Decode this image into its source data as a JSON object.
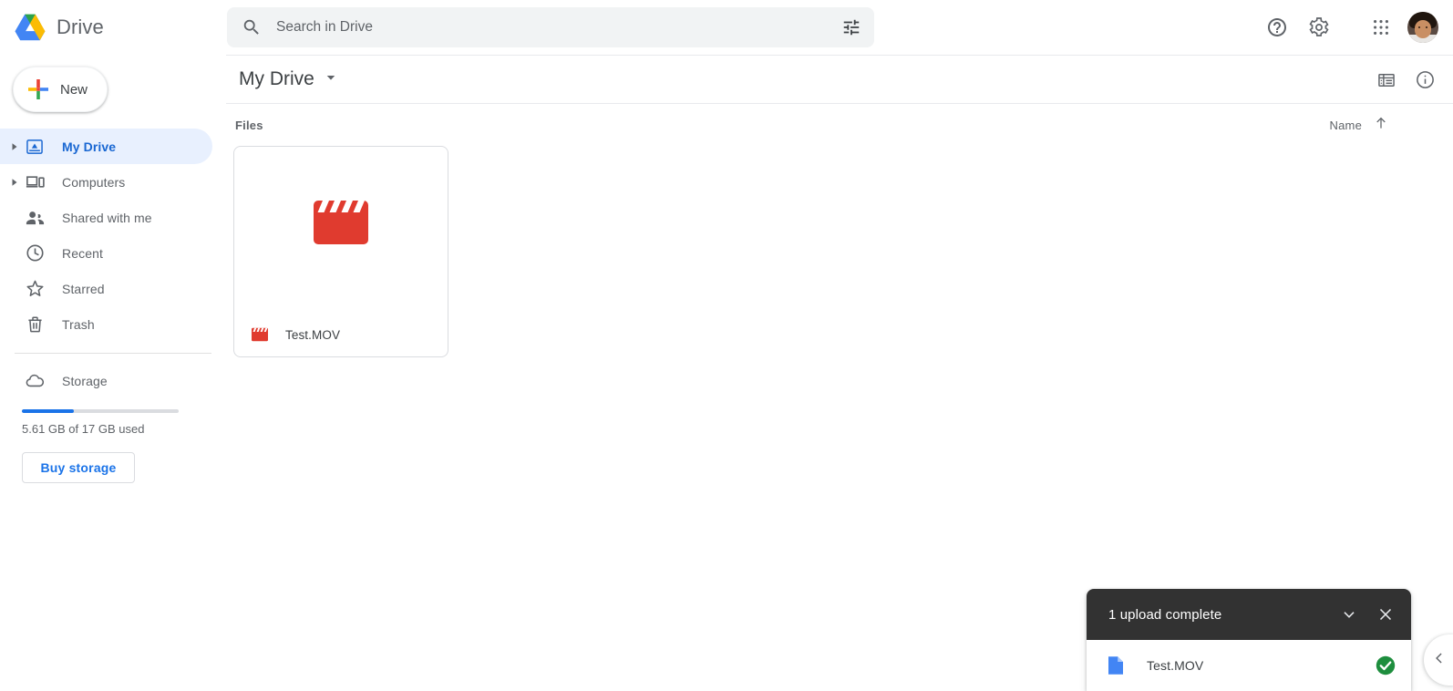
{
  "app": {
    "brand_name": "Drive",
    "logo_icon": "google-drive-logo"
  },
  "search": {
    "placeholder": "Search in Drive",
    "value": "",
    "search_icon": "search-icon",
    "options_icon": "tune-icon"
  },
  "topbar_actions": [
    {
      "name": "help-icon",
      "label": "Support"
    },
    {
      "name": "gear-icon",
      "label": "Settings"
    },
    {
      "name": "apps-grid-icon",
      "label": "Google apps"
    },
    {
      "name": "avatar",
      "label": "Google Account"
    }
  ],
  "sidebar": {
    "new_button": {
      "label": "New",
      "icon": "plus-icon"
    },
    "items": [
      {
        "label": "My Drive",
        "icon": "my-drive-icon",
        "expandable": true,
        "active": true
      },
      {
        "label": "Computers",
        "icon": "computers-icon",
        "expandable": true,
        "active": false
      },
      {
        "label": "Shared with me",
        "icon": "shared-with-me-icon",
        "expandable": false,
        "active": false
      },
      {
        "label": "Recent",
        "icon": "clock-icon",
        "expandable": false,
        "active": false
      },
      {
        "label": "Starred",
        "icon": "star-icon",
        "expandable": false,
        "active": false
      },
      {
        "label": "Trash",
        "icon": "trash-icon",
        "expandable": false,
        "active": false
      }
    ],
    "storage": {
      "label": "Storage",
      "icon": "cloud-icon",
      "usage_text": "5.61 GB of 17 GB used",
      "used_percent": 33,
      "bar_color": "#1a73e8",
      "buy_button_label": "Buy storage"
    }
  },
  "main": {
    "breadcrumb": {
      "label": "My Drive",
      "caret_icon": "chevron-down-icon"
    },
    "toolbar": [
      {
        "name": "list-view-icon",
        "label": "List view"
      },
      {
        "name": "info-icon",
        "label": "View details"
      }
    ],
    "section": {
      "title": "Files"
    },
    "sort": {
      "label": "Name",
      "direction_icon": "arrow-up-icon"
    },
    "files": [
      {
        "name": "Test.MOV",
        "type_icon": "video-clapper-icon",
        "accent": "#e03b2f"
      }
    ]
  },
  "upload_toast": {
    "title": "1 upload complete",
    "collapse_icon": "chevron-down-icon",
    "close_icon": "close-icon",
    "items": [
      {
        "name": "Test.MOV",
        "file_icon": "file-doc-icon",
        "status_icon": "check-circle-icon",
        "status_color": "#1e8e3e"
      }
    ]
  },
  "side_tab": {
    "icon": "chevron-left-icon",
    "label": "Expand panel"
  }
}
